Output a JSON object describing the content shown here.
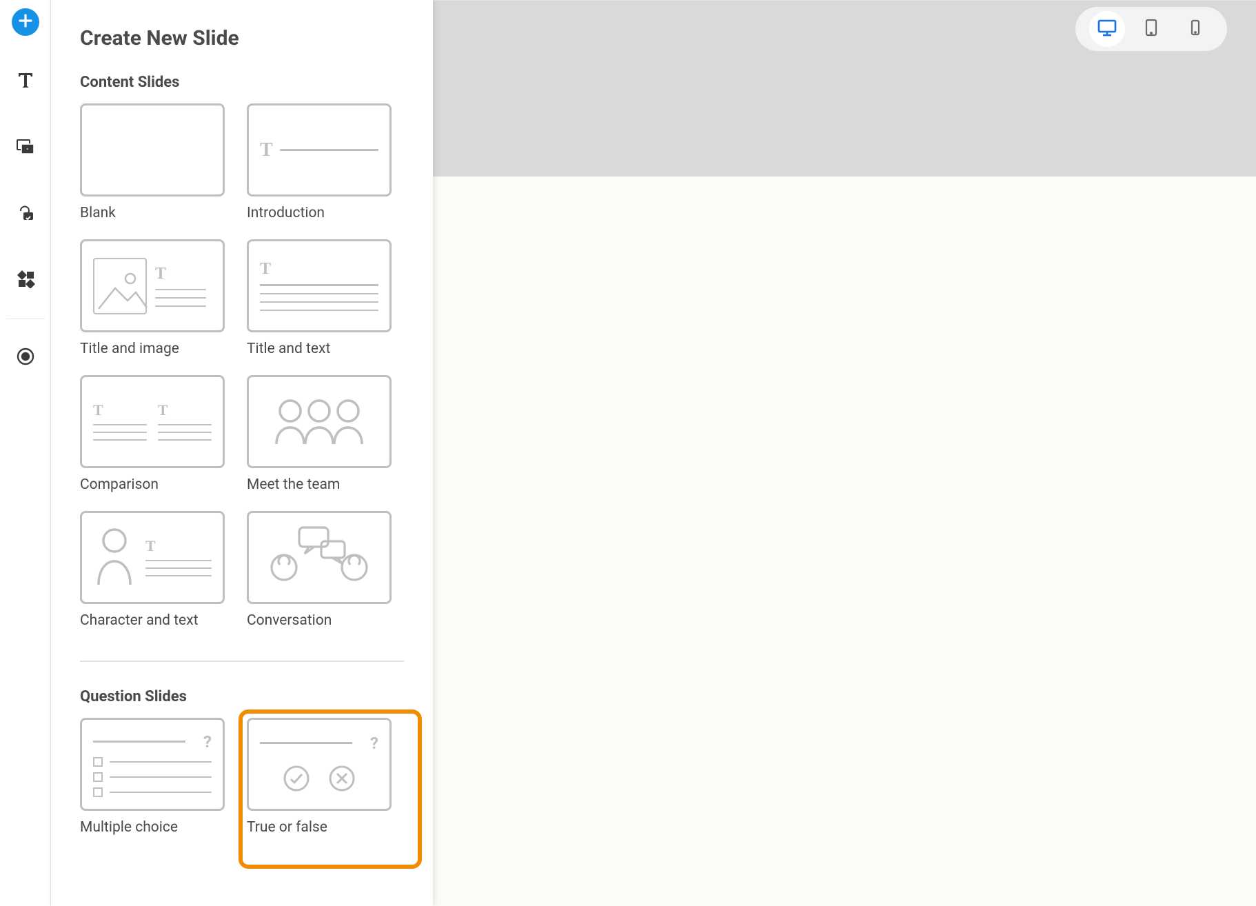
{
  "panel": {
    "title": "Create New Slide",
    "section1": "Content Slides",
    "section2": "Question Slides"
  },
  "contentSlides": {
    "blank": "Blank",
    "introduction": "Introduction",
    "titleImage": "Title and image",
    "titleText": "Title and text",
    "comparison": "Comparison",
    "meetTeam": "Meet the team",
    "characterText": "Character and text",
    "conversation": "Conversation"
  },
  "questionSlides": {
    "multipleChoice": "Multiple choice",
    "trueFalse": "True or false"
  },
  "toolbar": {
    "add": "add-icon",
    "text": "text-icon",
    "media": "media-icon",
    "brand": "brand-icon",
    "grid": "grid-icon",
    "record": "record-icon"
  },
  "devices": {
    "desktop": "desktop-icon",
    "tablet": "tablet-icon",
    "mobile": "mobile-icon"
  },
  "colors": {
    "accent": "#1592e6",
    "highlight": "#f08c00",
    "lineGray": "#bfbfbf",
    "textGray": "#4a4a4a"
  },
  "selected": "trueFalse"
}
